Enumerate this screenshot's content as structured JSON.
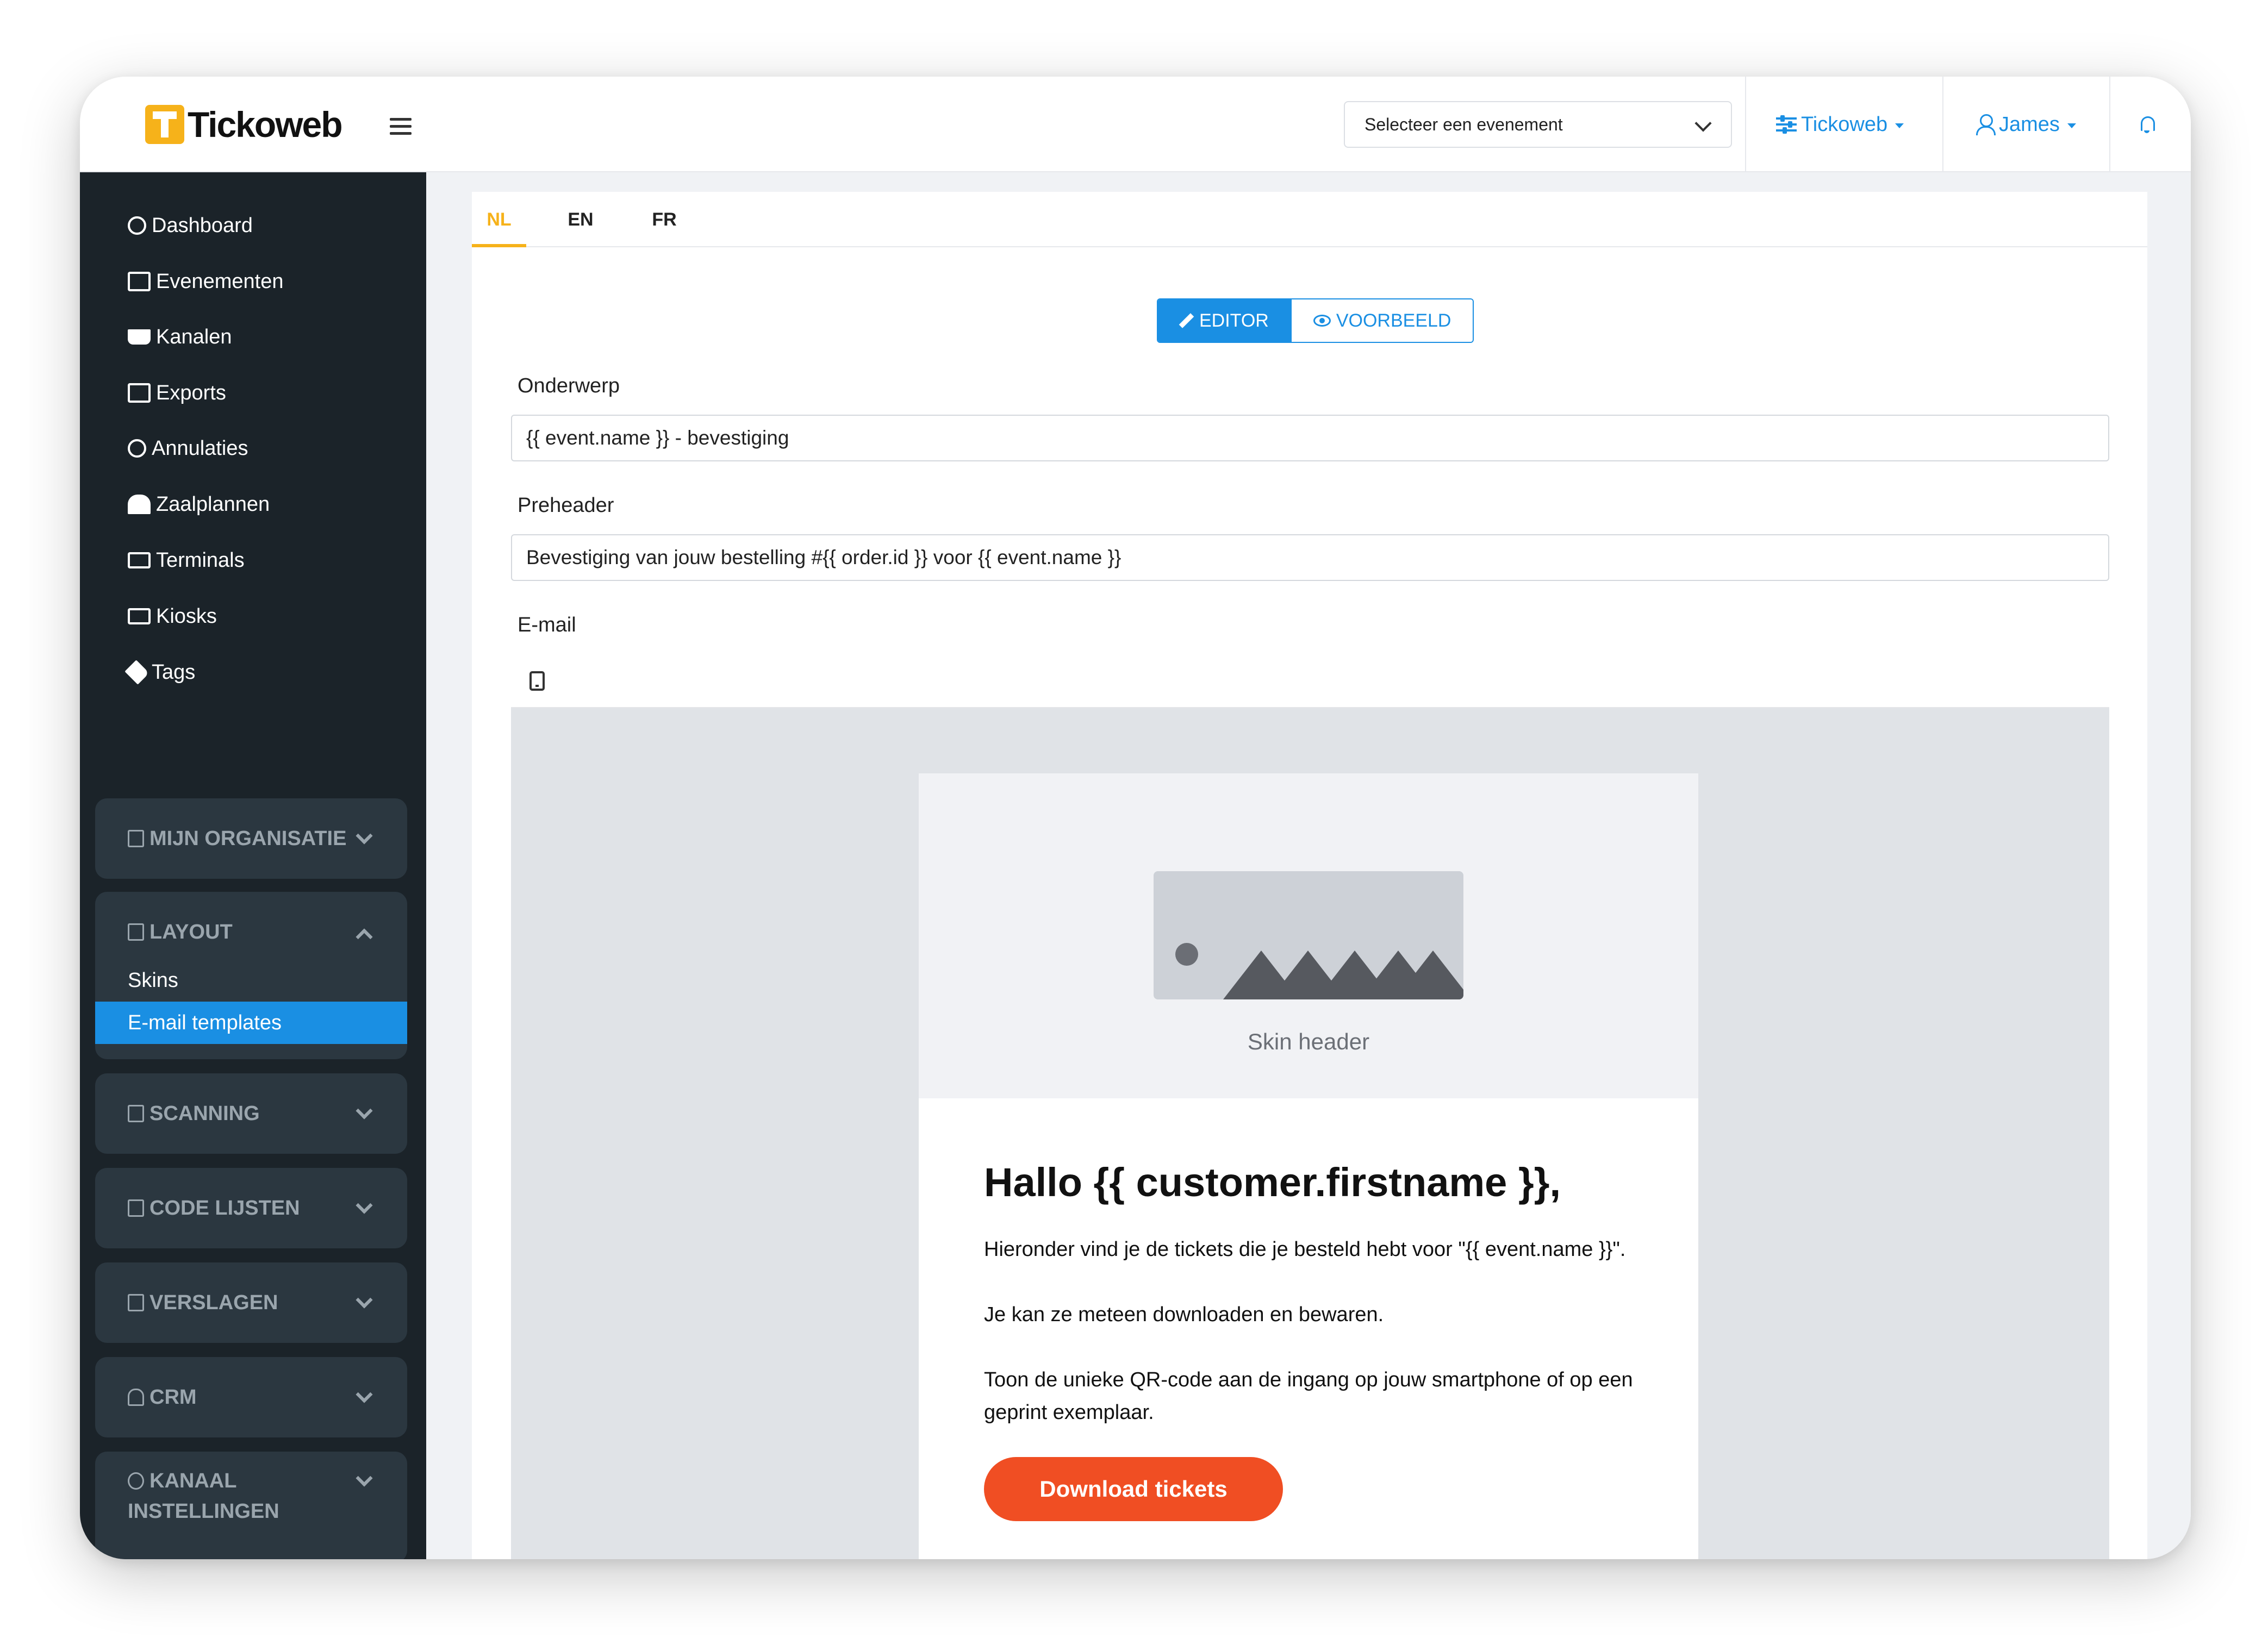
{
  "brand": {
    "name": "Tickoweb",
    "accent": "#f6b21a",
    "primary": "#1a8fe3",
    "cta": "#f04e23"
  },
  "topbar": {
    "event_select_placeholder": "Selecteer een evenement",
    "org_menu": "Tickoweb",
    "user_menu": "James",
    "icons": {
      "menu": "hamburger-icon",
      "org": "sliders-icon",
      "user": "user-icon",
      "notify": "bell-icon"
    }
  },
  "sidebar": {
    "items": [
      {
        "label": "Dashboard",
        "icon": "dashboard-icon"
      },
      {
        "label": "Evenementen",
        "icon": "film-icon"
      },
      {
        "label": "Kanalen",
        "icon": "cart-icon"
      },
      {
        "label": "Exports",
        "icon": "table-icon"
      },
      {
        "label": "Annulaties",
        "icon": "ban-icon"
      },
      {
        "label": "Zaalplannen",
        "icon": "building-icon"
      },
      {
        "label": "Terminals",
        "icon": "card-icon"
      },
      {
        "label": "Kiosks",
        "icon": "monitor-icon"
      },
      {
        "label": "Tags",
        "icon": "tags-icon"
      }
    ],
    "groups": [
      {
        "label": "MIJN ORGANISATIE",
        "expanded": false
      },
      {
        "label": "LAYOUT",
        "expanded": true,
        "children": [
          "Skins",
          "E-mail templates"
        ],
        "active_child": "E-mail templates"
      },
      {
        "label": "SCANNING",
        "expanded": false
      },
      {
        "label": "CODE LIJSTEN",
        "expanded": false
      },
      {
        "label": "VERSLAGEN",
        "expanded": false
      },
      {
        "label": "CRM",
        "expanded": false
      },
      {
        "label": "KANAAL",
        "label_line2": "INSTELLINGEN",
        "expanded": false
      }
    ]
  },
  "editor": {
    "lang_tabs": [
      "NL",
      "EN",
      "FR"
    ],
    "active_lang": "NL",
    "mode_editor": "EDITOR",
    "mode_preview": "VOORBEELD",
    "fields": {
      "subject_label": "Onderwerp",
      "subject_value": "{{ event.name }} - bevestiging",
      "preheader_label": "Preheader",
      "preheader_value": "Bevestiging van jouw bestelling #{{ order.id }} voor {{ event.name }}",
      "email_label": "E-mail"
    }
  },
  "email_preview": {
    "skin_header": "Skin header",
    "greeting": "Hallo {{ customer.firstname }},",
    "p1": "Hieronder vind je de tickets die je besteld hebt voor \"{{ event.name }}\".",
    "p2": "Je kan ze meteen downloaden en bewaren.",
    "p3": "Toon de unieke QR-code aan de ingang op jouw smartphone of op een geprint exemplaar.",
    "cta": "Download tickets"
  }
}
